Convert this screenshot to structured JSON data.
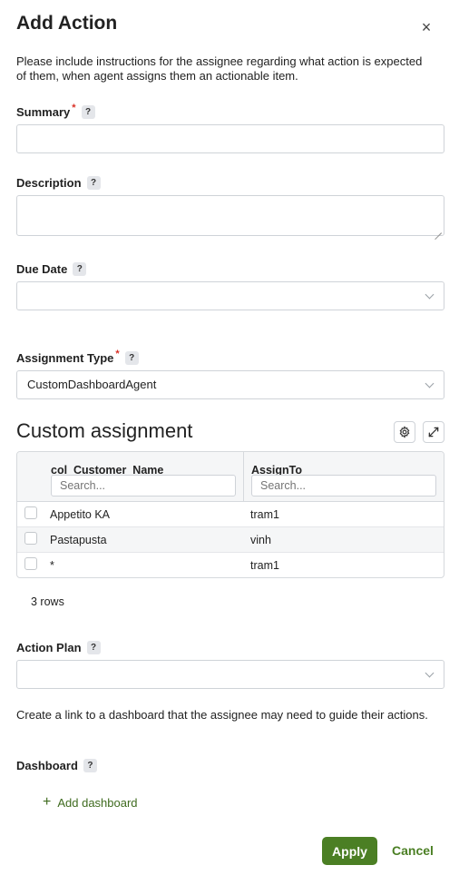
{
  "dialog": {
    "title": "Add Action",
    "close_label": "×",
    "intro": "Please include instructions for the assignee regarding what action is expected of them, when agent assigns them an actionable item."
  },
  "help_glyph": "?",
  "required_mark": "*",
  "fields": {
    "summary": {
      "label": "Summary",
      "value": ""
    },
    "description": {
      "label": "Description",
      "value": ""
    },
    "due_date": {
      "label": "Due Date",
      "value": ""
    },
    "assignment_type": {
      "label": "Assignment Type",
      "value": "CustomDashboardAgent"
    },
    "action_plan": {
      "label": "Action Plan",
      "value": ""
    },
    "dashboard": {
      "label": "Dashboard"
    }
  },
  "custom_assignment": {
    "title": "Custom assignment",
    "settings_icon": "gear-icon",
    "expand_icon": "expand-icon",
    "columns": [
      {
        "title": "col_Customer_Name",
        "search_placeholder": "Search..."
      },
      {
        "title": "AssignTo",
        "search_placeholder": "Search..."
      }
    ],
    "rows": [
      {
        "customer": "Appetito KA",
        "assign_to": "tram1"
      },
      {
        "customer": "Pastapusta",
        "assign_to": "vinh"
      },
      {
        "customer": "*",
        "assign_to": "tram1"
      }
    ],
    "row_count_text": "3 rows"
  },
  "dashboard_intro": "Create a link to a dashboard that the assignee may need to guide their actions.",
  "add_dashboard_label": "Add dashboard",
  "add_dashboard_icon": "plus-icon",
  "footer": {
    "apply_label": "Apply",
    "cancel_label": "Cancel"
  },
  "colors": {
    "accent": "#4b7f24",
    "required": "#d93025"
  }
}
